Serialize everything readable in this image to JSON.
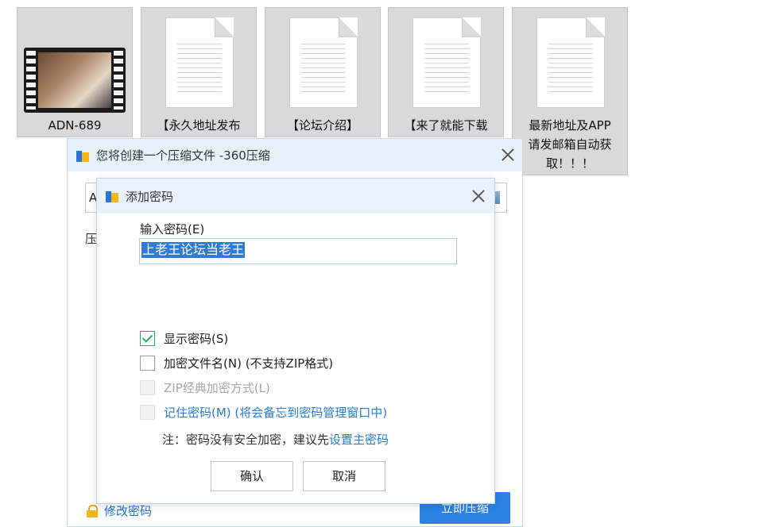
{
  "files": [
    {
      "label": "ADN-689",
      "type": "video"
    },
    {
      "label": "【永久地址发布",
      "type": "document"
    },
    {
      "label": "【论坛介绍】",
      "type": "document"
    },
    {
      "label": "【来了就能下载",
      "type": "document"
    },
    {
      "label": "最新地址及APP\n请发邮箱自动获\n取！！！",
      "type": "document"
    }
  ],
  "main_window": {
    "title": "您将创建一个压缩文件 -360压缩",
    "field_value_visible": "A",
    "label_visible": "压",
    "modify_password_label": "修改密码",
    "compress_button_label": "立即压缩"
  },
  "password_dialog": {
    "title": "添加密码",
    "input_label": "输入密码(E)",
    "password_value": "上老王论坛当老王",
    "options": {
      "show_password": {
        "label": "显示密码(S)",
        "checked": true
      },
      "encrypt_filenames": {
        "label": "加密文件名(N) (不支持ZIP格式)",
        "checked": false
      },
      "zip_classic": {
        "label": "ZIP经典加密方式(L)",
        "checked": false,
        "disabled": true
      },
      "remember_password": {
        "label": "记住密码(M) (将会备忘到密码管理窗口中)",
        "checked": false
      }
    },
    "note_text": "注：密码没有安全加密，建议先",
    "note_link": "设置主密码",
    "ok_label": "确认",
    "cancel_label": "取消"
  },
  "colors": {
    "accent": "#2a82e4",
    "link": "#2a7ad0",
    "check": "#2aa86a",
    "selection": "#2f7ad5",
    "titlebar": "#e7f1fc",
    "tile_bg": "#d9d9d9"
  },
  "icons": [
    "video-thumbnail-icon",
    "document-icon",
    "app-360-icon",
    "close-icon",
    "lock-icon",
    "checkbox-icon"
  ]
}
